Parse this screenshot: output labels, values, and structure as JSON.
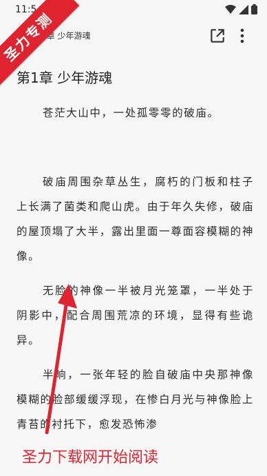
{
  "status_bar": {
    "time": "11:5"
  },
  "app_bar": {
    "title": "第1章 少年游魂",
    "share_icon": "open-external-icon",
    "more_icon": "more-vert-icon"
  },
  "chapter": {
    "title": "第1章 少年游魂"
  },
  "paragraphs": [
    "苍茫大山中，一处孤零零的破庙。",
    "破庙周围杂草丛生，腐朽的门板和柱子上长满了菌类和爬山虎。由于年久失修，破庙的屋顶塌了大半，露出里面一尊面容模糊的神像。",
    "无脸的神像一半被月光笼罩，一半处于阴影中，配合周围荒凉的环境，显得有些诡异。",
    "半晌，一张年轻的脸自破庙中央那神像模糊的脸部缓缓浮现，在惨白月光与神像脸上青苔的衬托下，愈发恐怖渗"
  ],
  "watermark": {
    "ribbon_text": "圣力专测",
    "promo_text": "圣力下载网开始阅读",
    "color": "#e0242f"
  }
}
